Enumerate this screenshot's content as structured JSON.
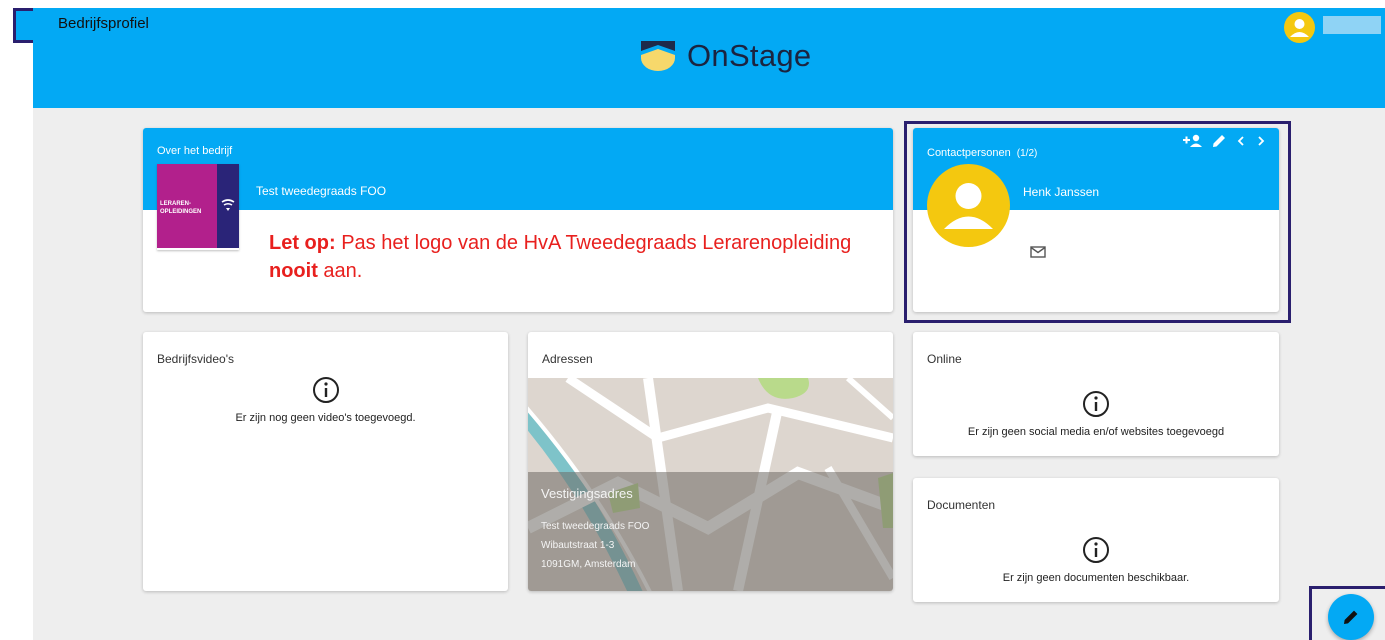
{
  "header": {
    "page_title": "Bedrijfsprofiel",
    "brand": "OnStage"
  },
  "about": {
    "title": "Over het bedrijf",
    "company_name": "Test tweedegraads FOO",
    "logo_text_line1": "LERAREN-",
    "logo_text_line2": "OPLEIDINGEN",
    "notice_bold": "Let op:",
    "notice_part1": " Pas het logo van de HvA Tweedegraads Lerarenopleiding ",
    "notice_bold2": "nooit",
    "notice_part2": " aan."
  },
  "contacts": {
    "title": "Contactpersonen",
    "count": "(1/2)",
    "name": "Henk Janssen"
  },
  "videos": {
    "title": "Bedrijfsvideo's",
    "empty_text": "Er zijn nog geen video's toegevoegd."
  },
  "addresses": {
    "title": "Adressen",
    "label": "Vestigingsadres",
    "line1": "Test tweedegraads FOO",
    "line2": "Wibautstraat 1-3",
    "line3": "1091GM, Amsterdam"
  },
  "online": {
    "title": "Online",
    "empty_text": "Er zijn geen social media en/of websites toegevoegd"
  },
  "documents": {
    "title": "Documenten",
    "empty_text": "Er zijn geen documenten beschikbaar."
  },
  "colors": {
    "primary": "#03a9f4",
    "highlight_frame": "#2a1f6e",
    "notice": "#e8201e",
    "avatar": "#f4c80f"
  },
  "icons": [
    "menu-icon",
    "onstage-logo-icon",
    "user-avatar-icon",
    "add-person-icon",
    "edit-icon",
    "chevron-left-icon",
    "chevron-right-icon",
    "mail-icon",
    "info-icon",
    "pencil-icon"
  ]
}
